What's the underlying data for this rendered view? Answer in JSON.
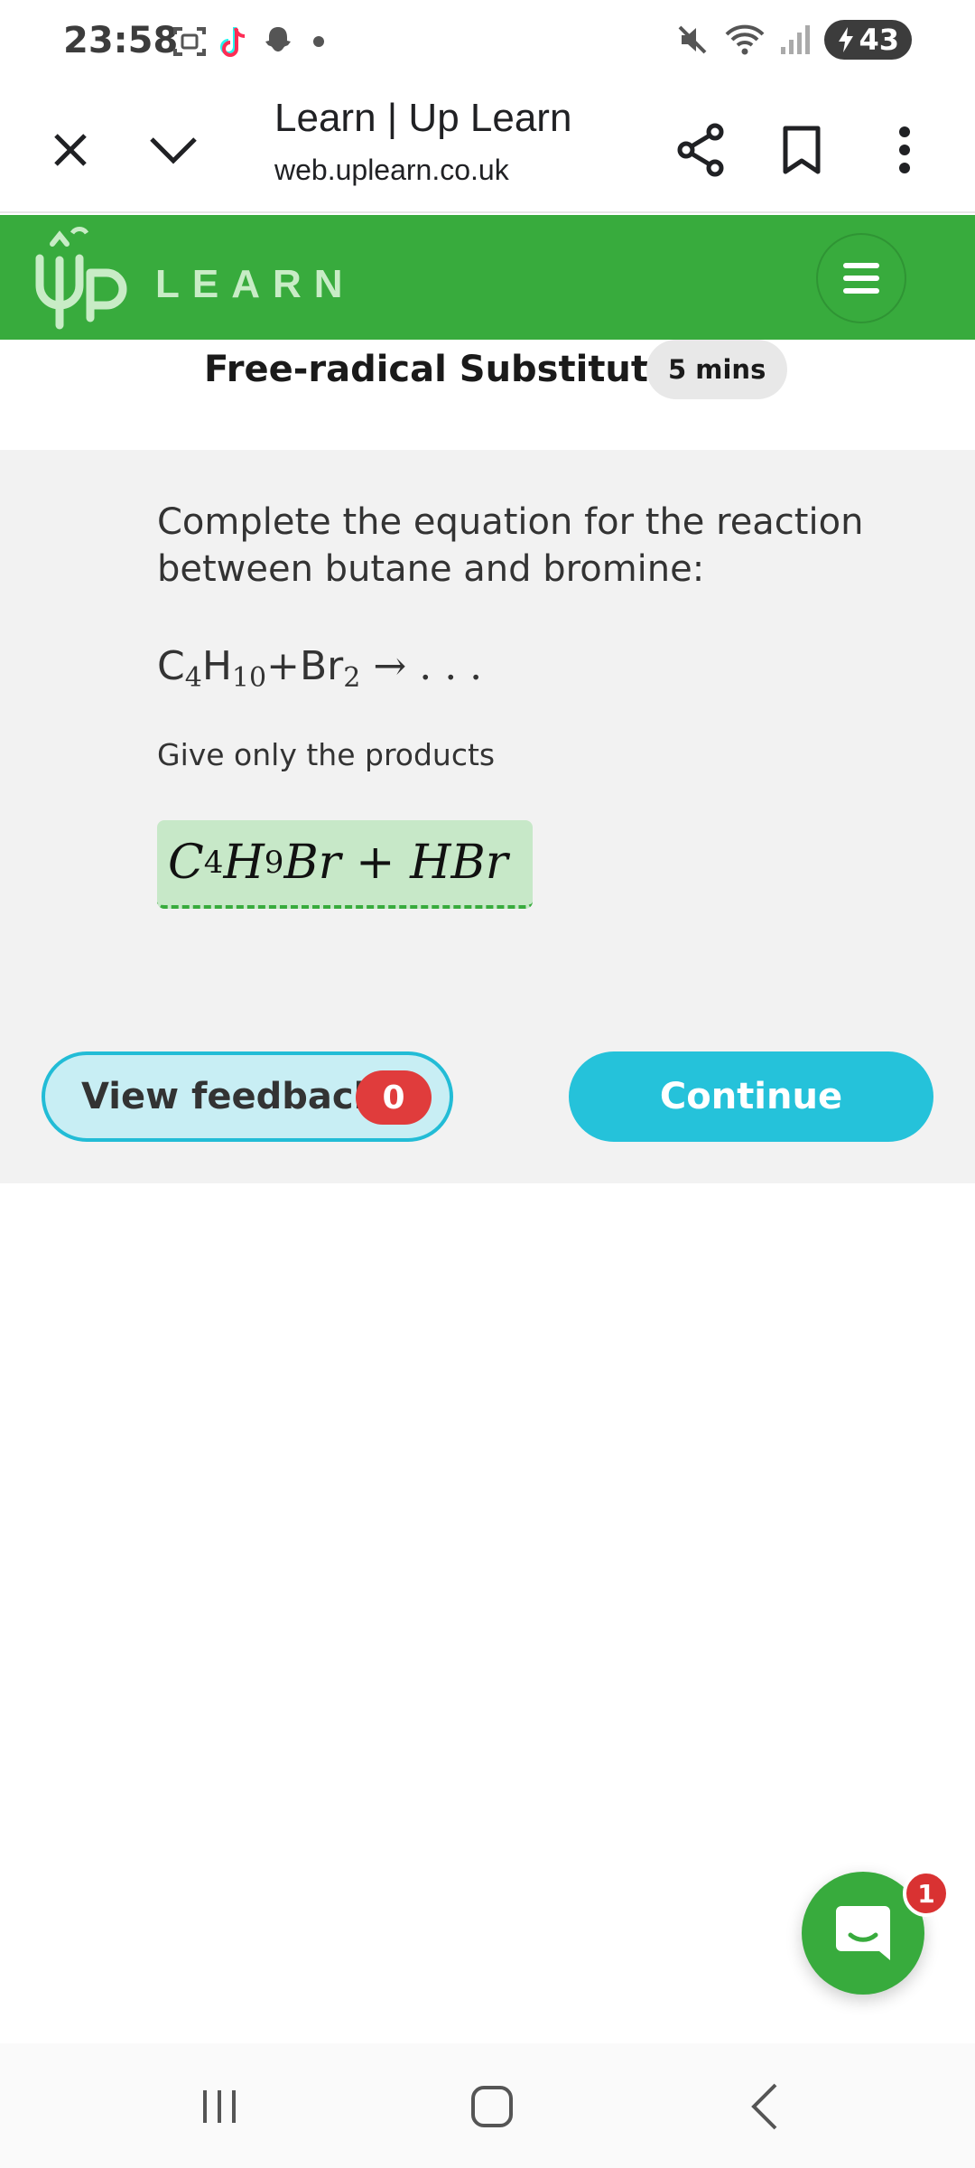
{
  "status_bar": {
    "time": "23:58",
    "battery_level": "43",
    "icons_left": [
      "screenshot-icon",
      "tiktok-icon",
      "snapchat-icon",
      "dot-icon"
    ],
    "icons_right": [
      "mute-icon",
      "wifi-icon",
      "signal-icon",
      "battery-charging-icon"
    ]
  },
  "browser": {
    "page_title": "Learn | Up Learn",
    "url": "web.uplearn.co.uk",
    "buttons": [
      "close-icon",
      "chevron-down-icon",
      "share-icon",
      "bookmark-icon",
      "more-vert-icon"
    ]
  },
  "header": {
    "logo_text": "LEARN",
    "brand_color": "#38ab3d"
  },
  "lesson": {
    "title": "Free-radical Substitution",
    "duration": "5 mins"
  },
  "question": {
    "prompt": "Complete the equation for the reaction between butane and bromine:",
    "equation": {
      "c": "C",
      "c_sub": "4",
      "h": "H",
      "h_sub": "10",
      "plus": "+",
      "br": "Br",
      "br_sub": "2",
      "arrow": "→",
      "ellipsis": ". . ."
    },
    "hint": "Give only the products",
    "answer": {
      "c": "C",
      "c_sub": "4",
      "h": "H",
      "h_sub": "9",
      "rest": "Br + HBr"
    }
  },
  "actions": {
    "feedback_label": "View feedback",
    "feedback_count": "0",
    "continue_label": "Continue",
    "accent_color": "#25c2da"
  },
  "chat": {
    "unread_count": "1"
  }
}
